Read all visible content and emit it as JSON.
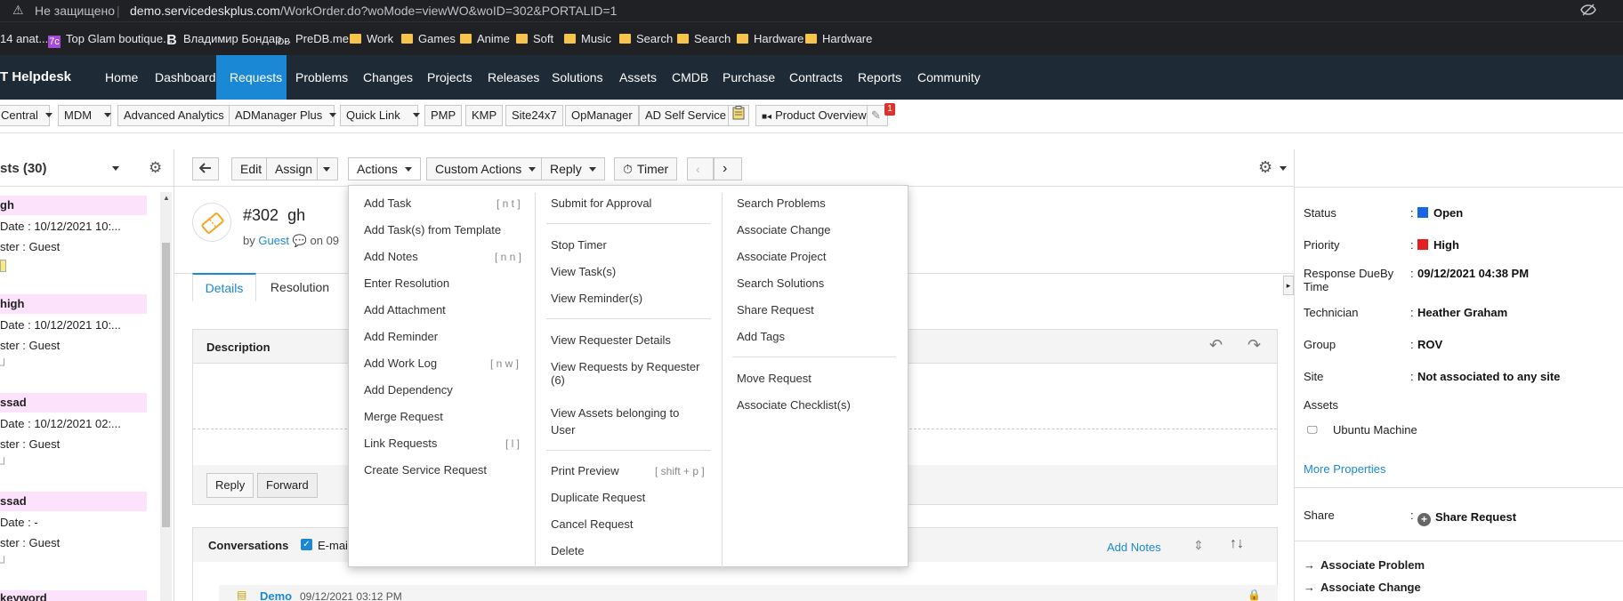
{
  "browser": {
    "security_label": "Не защищено",
    "url_host": "demo.servicedeskplus.com",
    "url_path": "/WorkOrder.do?woMode=viewWO&woID=302&PORTALID=1",
    "bookmarks": [
      "14 anat...",
      "Top Glam boutique...",
      "Владимир Бондар...",
      "PreDB.me",
      "Work",
      "Games",
      "Anime",
      "Soft",
      "Music",
      "Search",
      "Search",
      "Hardware",
      "Hardware"
    ]
  },
  "app": {
    "title": "T Helpdesk",
    "nav": [
      "Home",
      "Dashboard",
      "Requests",
      "Problems",
      "Changes",
      "Projects",
      "Releases",
      "Solutions",
      "Assets",
      "CMDB",
      "Purchase",
      "Contracts",
      "Reports",
      "Community"
    ],
    "active_nav": "Requests"
  },
  "toolbar": {
    "items": [
      "Central",
      "MDM",
      "Advanced Analytics",
      "ADManager Plus",
      "Quick Link",
      "PMP",
      "KMP",
      "Site24x7",
      "OpManager",
      "AD Self Service",
      "Product Overview"
    ],
    "badge": "1"
  },
  "left": {
    "title": "sts (30)",
    "items": [
      {
        "title": "gh",
        "date_label": "Date",
        "date": "10/12/2021 10:...",
        "req_label": "ster",
        "req": "Guest"
      },
      {
        "title": "high",
        "date_label": "Date",
        "date": "10/12/2021 10:...",
        "req_label": "ster",
        "req": "Guest"
      },
      {
        "title": "ssad",
        "date_label": "Date",
        "date": "10/12/2021 02:...",
        "req_label": "ster",
        "req": "Guest"
      },
      {
        "title": "ssad",
        "date_label": "Date",
        "date": "-",
        "req_label": "ster",
        "req": "Guest"
      },
      {
        "title": "keyword"
      }
    ]
  },
  "mainbar": {
    "edit": "Edit",
    "assign": "Assign",
    "actions": "Actions",
    "custom_actions": "Custom Actions",
    "reply": "Reply",
    "timer": "Timer"
  },
  "ticket": {
    "id": "#302",
    "subject": "gh",
    "by": "by",
    "requester": "Guest",
    "on": "on",
    "date_partial": "09",
    "tabs": [
      "Details",
      "Resolution"
    ],
    "description_label": "Description",
    "reply_btn": "Reply",
    "forward_btn": "Forward",
    "conversations_label": "Conversations",
    "email_label": "E-mai",
    "add_notes": "Add Notes",
    "conv_author": "Demo",
    "conv_date": "09/12/2021 03:12 PM"
  },
  "actions_menu": {
    "col1": [
      {
        "label": "Add Task",
        "shortcut": "[ n t ]"
      },
      {
        "label": "Add Task(s) from Template",
        "shortcut": ""
      },
      {
        "label": "Add Notes",
        "shortcut": "[ n n ]"
      },
      {
        "label": "Enter Resolution",
        "shortcut": ""
      },
      {
        "label": "Add Attachment",
        "shortcut": ""
      },
      {
        "label": "Add Reminder",
        "shortcut": ""
      },
      {
        "label": "Add Work Log",
        "shortcut": "[ n w ]"
      },
      {
        "label": "Add Dependency",
        "shortcut": ""
      },
      {
        "label": "Merge Request",
        "shortcut": ""
      },
      {
        "label": "Link Requests",
        "shortcut": "[ l ]"
      },
      {
        "label": "Create Service Request",
        "shortcut": ""
      }
    ],
    "col2": {
      "submit": "Submit for Approval",
      "stop_timer": "Stop Timer",
      "view_tasks": "View Task(s)",
      "view_reminders": "View Reminder(s)",
      "view_requester": "View Requester Details",
      "view_requests_line1": "View Requests by Requester",
      "view_requests_line2": "(6)",
      "view_assets_line1": "View Assets belonging to",
      "view_assets_line2": "User",
      "print": "Print Preview",
      "print_shortcut": "[ shift + p ]",
      "duplicate": "Duplicate Request",
      "cancel": "Cancel Request",
      "delete": "Delete"
    },
    "col3": {
      "search_problems": "Search Problems",
      "associate_change": "Associate Change",
      "associate_project": "Associate Project",
      "search_solutions": "Search Solutions",
      "share_request": "Share Request",
      "add_tags": "Add Tags",
      "move_request": "Move Request",
      "associate_checklist": "Associate Checklist(s)"
    }
  },
  "right": {
    "status_label": "Status",
    "status": "Open",
    "status_color": "#1565e6",
    "priority_label": "Priority",
    "priority": "High",
    "priority_color": "#e41f1f",
    "due_label1": "Response DueBy",
    "due_label2": "Time",
    "due": "09/12/2021 04:38 PM",
    "tech_label": "Technician",
    "tech": "Heather Graham",
    "group_label": "Group",
    "group": "ROV",
    "site_label": "Site",
    "site": "Not associated to any site",
    "assets_label": "Assets",
    "asset": "Ubuntu Machine",
    "more": "More Properties",
    "share_label": "Share",
    "share": "Share Request",
    "assoc_problem": "Associate Problem",
    "assoc_change": "Associate Change"
  }
}
